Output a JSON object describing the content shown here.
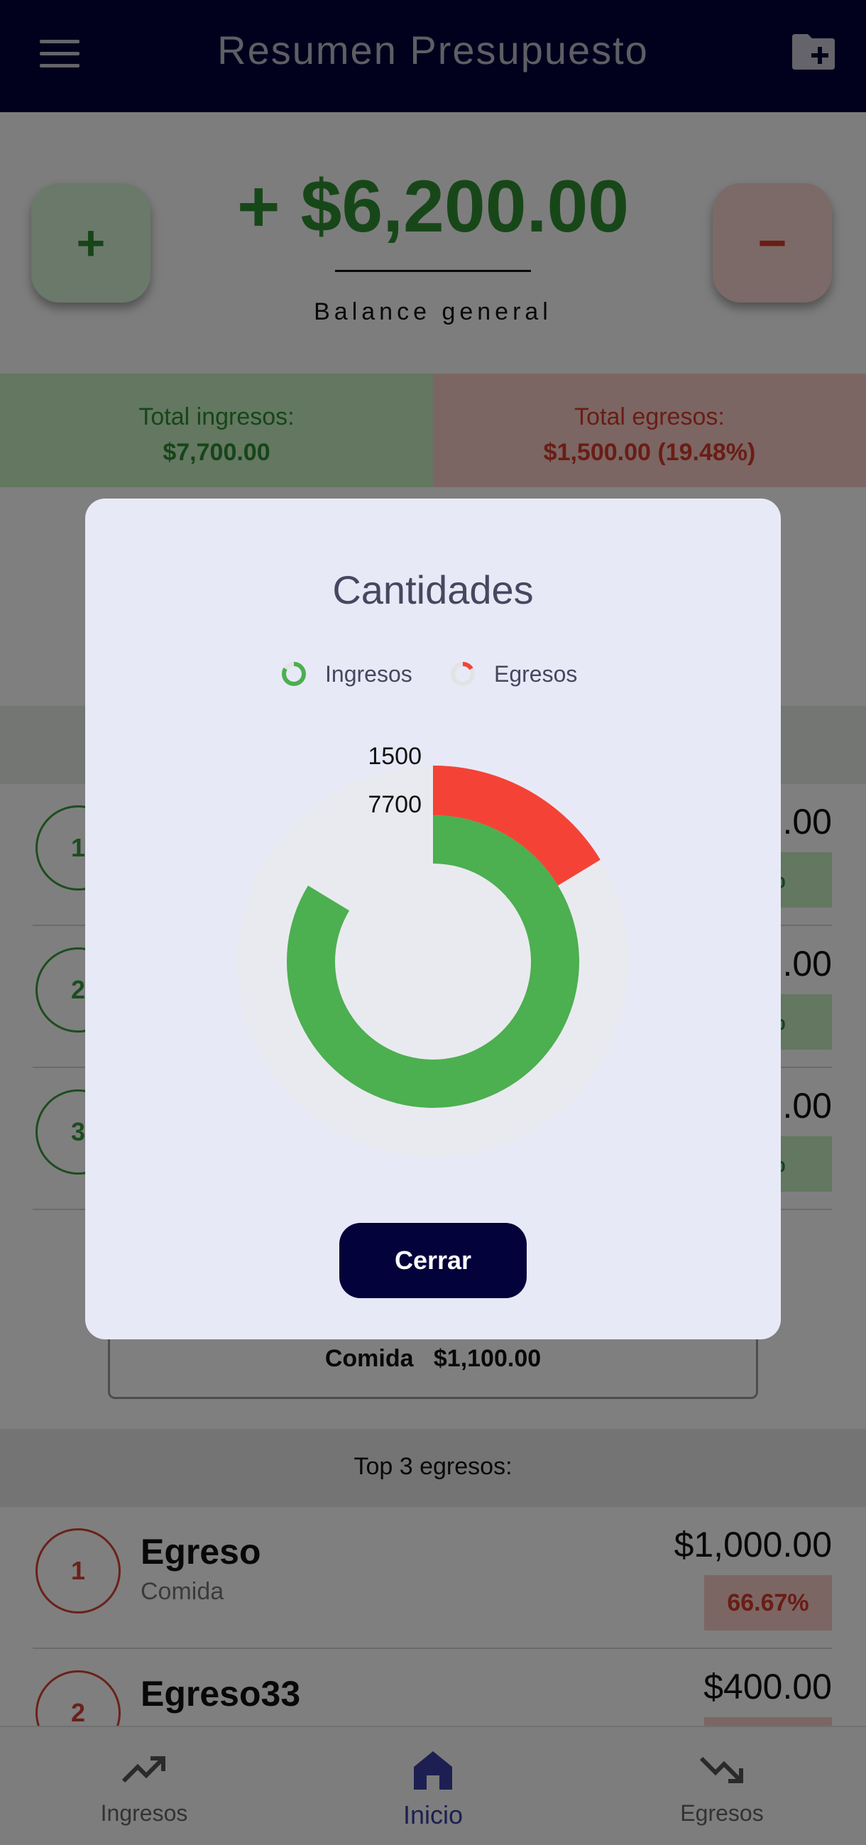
{
  "appbar": {
    "title": "Resumen Presupuesto",
    "menu_icon": "hamburger-icon",
    "action_icon": "folder-add-icon"
  },
  "balance": {
    "amount": "+ $6,200.00",
    "label": "Balance general",
    "add_label": "+",
    "subtract_label": "−"
  },
  "totals": {
    "income_label": "Total ingresos:",
    "income_value": "$7,700.00",
    "expense_label": "Total egresos:",
    "expense_value": "$1,500.00 (19.48%)"
  },
  "top_ingresos": {
    "rows": [
      {
        "rank": "1",
        "amount": ".00",
        "percent": "7%"
      },
      {
        "rank": "2",
        "amount": ".00",
        "percent": "7%"
      },
      {
        "rank": "3",
        "amount": ".00",
        "percent": "9%"
      }
    ]
  },
  "category_summary": {
    "name": "Comida",
    "amount": "$1,100.00"
  },
  "top_egresos": {
    "title": "Top 3 egresos:",
    "rows": [
      {
        "rank": "1",
        "name": "Egreso",
        "category": "Comida",
        "amount": "$1,000.00",
        "percent": "66.67%"
      },
      {
        "rank": "2",
        "name": "Egreso33",
        "category": "",
        "amount": "$400.00",
        "percent": ""
      }
    ]
  },
  "bottom_nav": {
    "items": [
      {
        "label": "Ingresos",
        "icon": "trending-up-icon"
      },
      {
        "label": "Inicio",
        "icon": "home-icon"
      },
      {
        "label": "Egresos",
        "icon": "trending-down-icon"
      }
    ]
  },
  "dialog": {
    "title": "Cantidades",
    "close_label": "Cerrar",
    "chart_data": {
      "type": "pie",
      "series": [
        {
          "name": "Ingresos",
          "values": [
            7700
          ],
          "color": "#4caf50"
        },
        {
          "name": "Egresos",
          "values": [
            1500
          ],
          "color": "#f44336"
        }
      ],
      "total": 9200,
      "data_labels": [
        "1500",
        "7700"
      ],
      "legend": "top"
    }
  }
}
